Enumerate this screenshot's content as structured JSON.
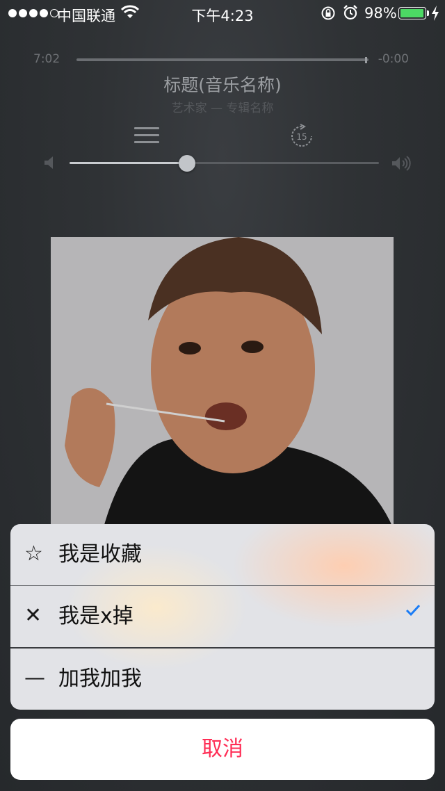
{
  "status_bar": {
    "carrier": "中国联通",
    "time": "下午4:23",
    "battery_percent": "98%",
    "battery_level": 0.98,
    "signal_bars_filled": 4,
    "signal_bars_total": 5
  },
  "player": {
    "elapsed": "7:02",
    "remaining": "-0:00",
    "progress": 1.0,
    "title": "标题(音乐名称)",
    "subtitle": "艺术家 — 专辑名称",
    "skip_seconds": "15",
    "volume": 0.38
  },
  "action_sheet": {
    "items": [
      {
        "icon": "star-outline-icon",
        "glyph": "☆",
        "label": "我是收藏",
        "checked": false
      },
      {
        "icon": "close-icon",
        "glyph": "✕",
        "label": "我是x掉",
        "checked": true
      },
      {
        "icon": "minus-icon",
        "glyph": "—",
        "label": "加我加我",
        "checked": false
      }
    ],
    "cancel_label": "取消"
  },
  "colors": {
    "accent_check": "#1a7cf5",
    "cancel_text": "#ff2d55",
    "battery_fill": "#4cd964"
  }
}
